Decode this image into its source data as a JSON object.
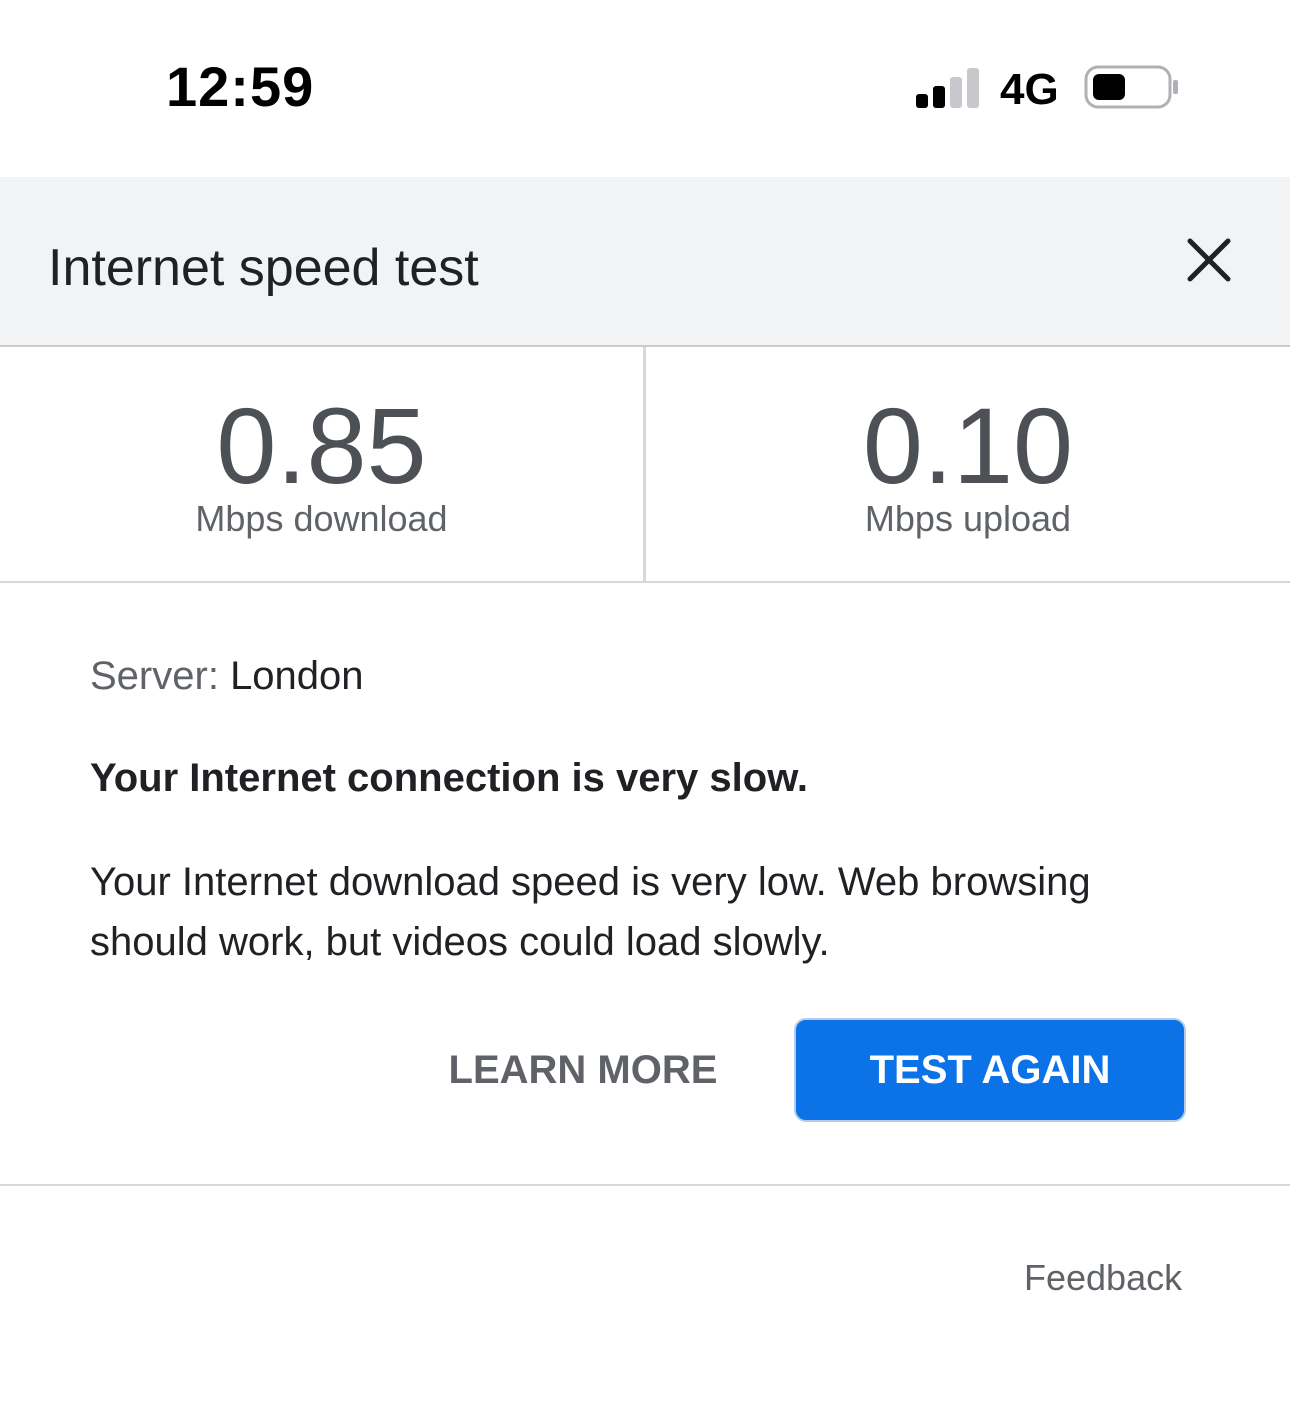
{
  "status_bar": {
    "time": "12:59",
    "network": "4G",
    "signal_bars_filled": 2,
    "signal_bars_total": 4,
    "battery_level": 0.4
  },
  "header": {
    "title": "Internet speed test",
    "close_icon": "close-icon"
  },
  "results": {
    "download": {
      "value": "0.85",
      "unit": "Mbps download"
    },
    "upload": {
      "value": "0.10",
      "unit": "Mbps upload"
    }
  },
  "details": {
    "server_label": "Server:",
    "server_value": "London",
    "heading": "Your Internet connection is very slow.",
    "description": "Your Internet download speed is very low. Web browsing should work, but videos could load slowly."
  },
  "actions": {
    "learn_more": "LEARN MORE",
    "test_again": "TEST AGAIN"
  },
  "footer": {
    "feedback": "Feedback"
  },
  "colors": {
    "accent": "#0b72e7",
    "header_bg": "#f1f3f4",
    "muted_text": "#5f6368"
  }
}
